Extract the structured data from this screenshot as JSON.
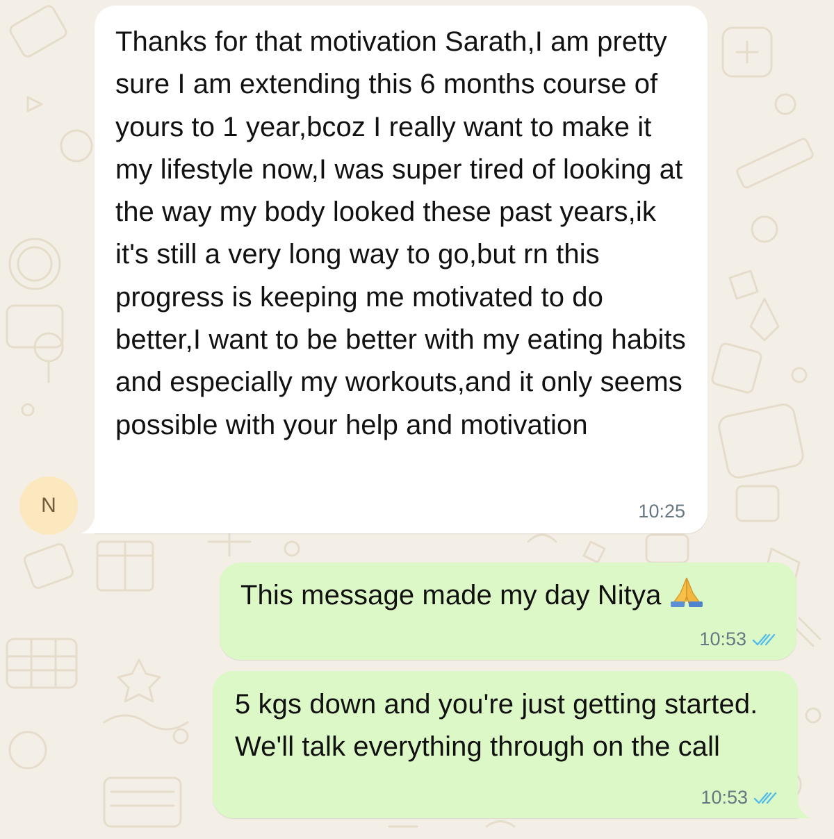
{
  "chat": {
    "contact_initial": "N",
    "messages": [
      {
        "direction": "incoming",
        "text": "Thanks for that motivation Sarath,I am pretty sure I am extending this 6 months course of yours to 1 year,bcoz I really want to make it my lifestyle now,I was super tired of looking at the way my body looked these past years,ik it's still a very long way to go,but rn this progress is keeping me motivated to do better,I want to be better with my eating habits and especially my workouts,and it only seems possible with your help and motivation",
        "time": "10:25"
      },
      {
        "direction": "outgoing",
        "text": "This message made my day Nitya",
        "emoji": "folded-hands-icon",
        "time": "10:53",
        "status": "read"
      },
      {
        "direction": "outgoing",
        "text": "5 kgs down and you're just getting started. We'll talk everything through on the call",
        "time": "10:53",
        "status": "read"
      }
    ]
  },
  "colors": {
    "wallpaper": "#f4efe6",
    "incoming_bubble": "#ffffff",
    "outgoing_bubble": "#dcf8c6",
    "avatar_bg": "#fbe8bf",
    "read_ticks": "#53bdeb",
    "timestamp": "#667781"
  }
}
